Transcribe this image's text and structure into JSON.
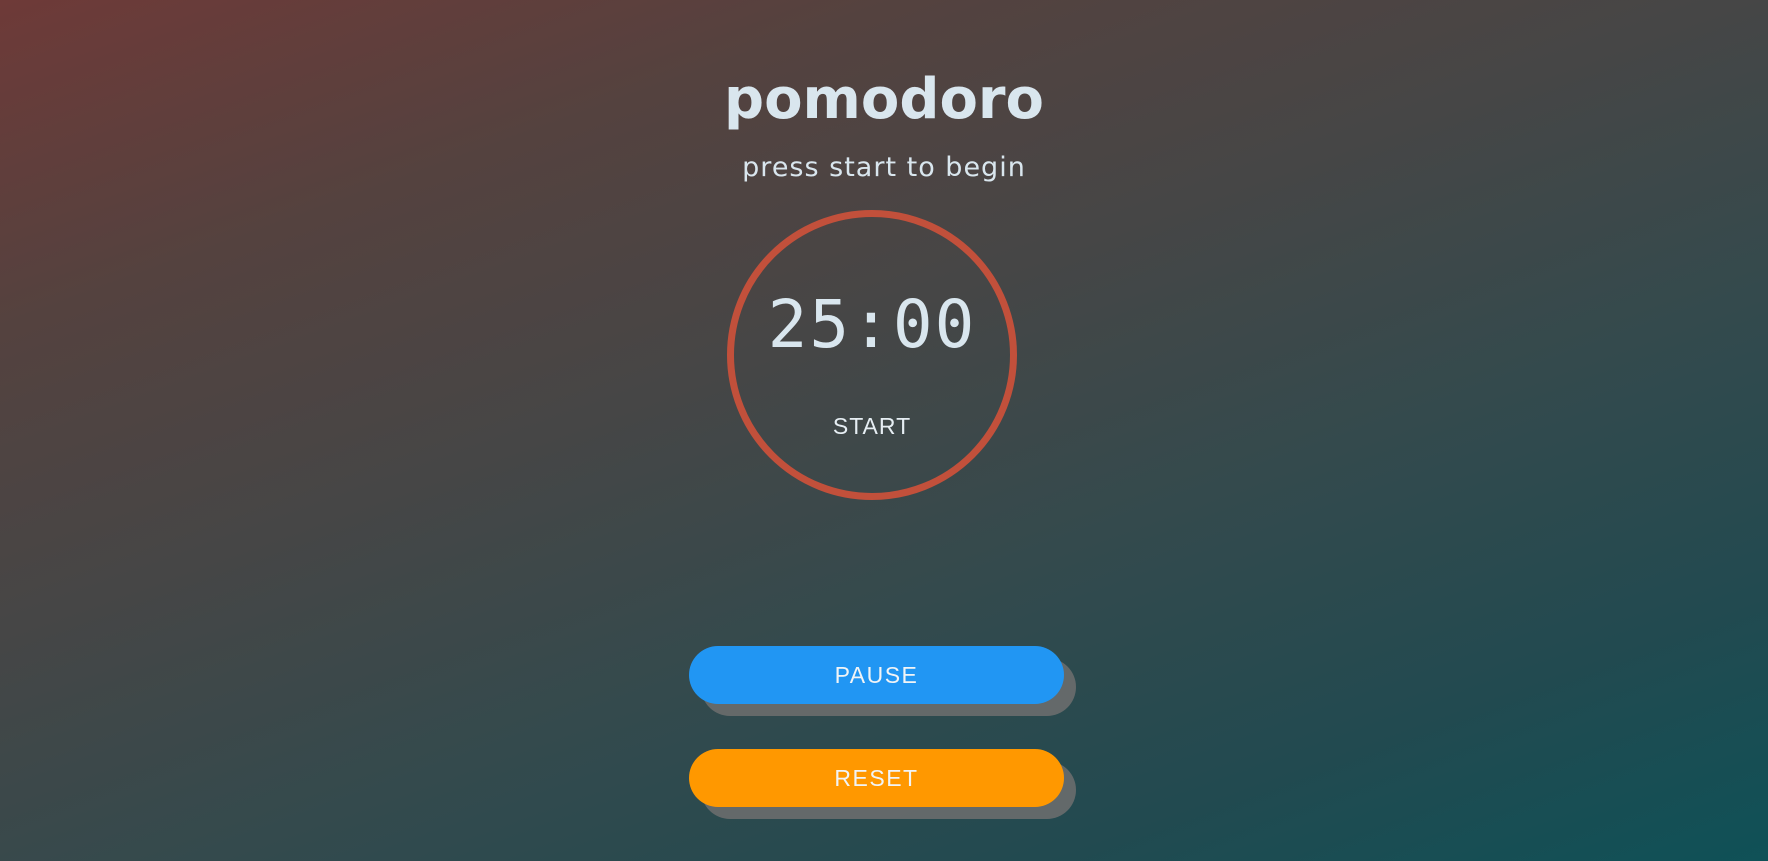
{
  "app": {
    "title": "pomodoro",
    "subtitle": "press start to begin"
  },
  "timer": {
    "time": "25:00",
    "action_label": "START",
    "ring_color": "#c2503b"
  },
  "controls": {
    "pause_label": "PAUSE",
    "pause_color": "#2196f3",
    "reset_label": "RESET",
    "reset_color": "#ff9800"
  }
}
